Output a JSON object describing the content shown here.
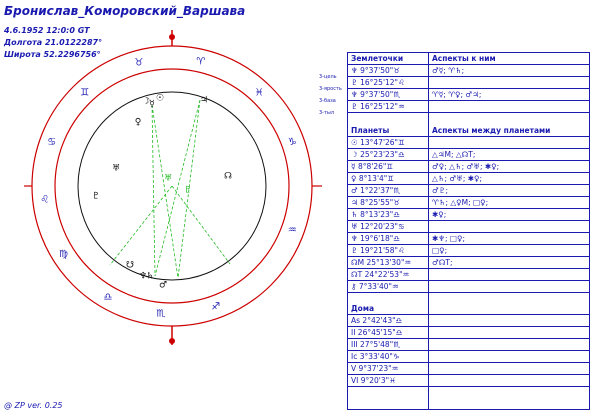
{
  "header": {
    "title": "Бронислав_Коморовский_Варшава",
    "date_time": "4.6.1952 12:0:0 GT",
    "longitude": "Долгота 21.0122287°",
    "latitude": "Широта 52.2296756°"
  },
  "wheel": {
    "zodiac_glyphs": [
      "♈",
      "♉",
      "♊",
      "♋",
      "♌",
      "♍",
      "♎",
      "♏",
      "♐",
      "♑",
      "♒",
      "♓"
    ],
    "planet_glyphs": [
      "☉",
      "☽",
      "☿",
      "♀",
      "♂",
      "♃",
      "♄",
      "♅",
      "♆",
      "♇",
      "☊",
      "☋"
    ],
    "axis_labels": [
      "3-цель",
      "3-ярость",
      "3-база",
      "3-тыл"
    ]
  },
  "table": {
    "section1": {
      "col1": "Землеточки",
      "col2": "Аспекты к ним",
      "rows": [
        {
          "c1": "♆ 9°37'50\"♉",
          "c2": "♂☿; ♈♄;"
        },
        {
          "c1": "♇ 16°25'12\"♌",
          "c2": ""
        },
        {
          "c1": "♆ 9°37'50\"♏",
          "c2": "♈☿; ♈♀; ♂♃;"
        },
        {
          "c1": "♇ 16°25'12\"♒",
          "c2": ""
        }
      ]
    },
    "section2": {
      "col1": "Планеты",
      "col2": "Аспекты между планетами",
      "rows": [
        {
          "c1": "☉ 13°47'26\"♊",
          "c2": ""
        },
        {
          "c1": "☽ 25°23'23\"♎",
          "c2": "△♃M; △☊T;"
        },
        {
          "c1": "☿ 8°8'26\"♊",
          "c2": "♂♀; △♄; ♂♅; ✱♀;"
        },
        {
          "c1": "♀ 8°13'4\"♊",
          "c2": "△♄; ♂♅; ✱♀;"
        },
        {
          "c1": "♂ 1°22'37\"♏",
          "c2": "♂♇;"
        },
        {
          "c1": "♃ 8°25'55\"♉",
          "c2": "♈♄; △♀M; □♀;"
        },
        {
          "c1": "♄ 8°13'23\"♎",
          "c2": "✱♀;"
        },
        {
          "c1": "♅ 12°20'23\"♋",
          "c2": ""
        },
        {
          "c1": "♆ 19°6'18\"♎",
          "c2": "✱♆; □♀;"
        },
        {
          "c1": "♇ 19°21'58\"♌",
          "c2": "□♀;"
        },
        {
          "c1": "☊M 25°13'30\"♒",
          "c2": "♂☊T;"
        },
        {
          "c1": "☊T 24°22'53\"♒",
          "c2": ""
        },
        {
          "c1": "⚷ 7°33'40\"♒",
          "c2": ""
        }
      ]
    },
    "section3": {
      "col1": "Дома",
      "rows": [
        {
          "c1": "As 2°42'43\"♎"
        },
        {
          "c1": "II 26°45'15\"♎"
        },
        {
          "c1": "III 27°5'48\"♏"
        },
        {
          "c1": "Ic 3°33'40\"♑"
        },
        {
          "c1": "V 9°37'23\"♒"
        },
        {
          "c1": "VI 9°20'3\"♓"
        }
      ]
    }
  },
  "footer": "@ ZP  ver. 0.25",
  "colors": {
    "text": "#1a1ab0",
    "red": "#cc0000",
    "aspect": "#22bb22"
  }
}
